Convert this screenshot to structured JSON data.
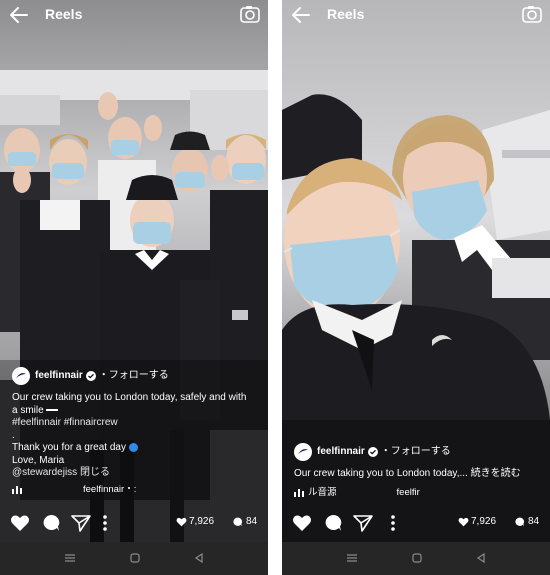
{
  "left": {
    "topbar": {
      "title": "Reels"
    },
    "caption": {
      "account": "feelfinnair",
      "follow": "・フォローする",
      "line1": "Our crew taking you to London today, safely and with",
      "line2": "a smile",
      "hashtags": " #feelfinnair #finnaircrew",
      "dot": ".",
      "thanks": "Thank you for a great day",
      "signoff": "Love, Maria",
      "mention": "@stewardejiss",
      "close": "閉じる",
      "audio": "feelfinnair・:"
    },
    "actions": {
      "likes": "7,926",
      "comments": "84"
    }
  },
  "right": {
    "topbar": {
      "title": "Reels"
    },
    "caption": {
      "account": "feelfinnair",
      "follow": "・フォローする",
      "line1": "Our crew taking you to London today,...",
      "read_more": "続きを読む",
      "audio_prefix": "ル音源",
      "audio_account": "feelfir"
    },
    "actions": {
      "likes": "7,926",
      "comments": "84"
    }
  },
  "colors": {
    "brand_blue": "#0b1560",
    "navbar": "#262626",
    "uniform": "#1e1e22",
    "mask": "#a9cfe4"
  },
  "icons": [
    "back-arrow-icon",
    "camera-icon",
    "verified-icon",
    "heart-icon",
    "comment-icon",
    "send-icon",
    "more-icon",
    "like-small-icon",
    "comment-small-icon",
    "audio-bars-icon",
    "nav-recent-icon",
    "nav-home-icon",
    "nav-back-icon"
  ]
}
